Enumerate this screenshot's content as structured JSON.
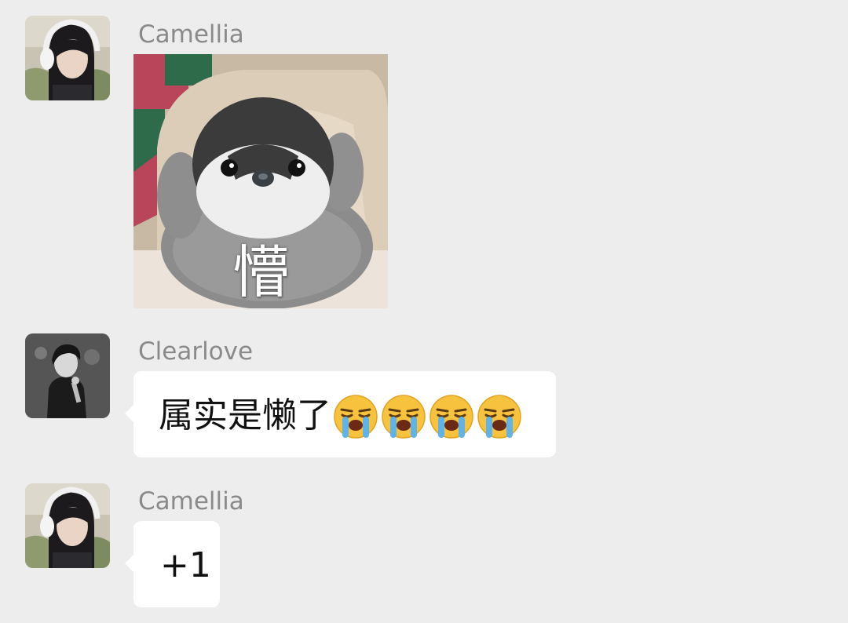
{
  "colors": {
    "background": "#ededed",
    "bubble": "#ffffff",
    "sender_name": "#8a8a8a",
    "message_text": "#111111"
  },
  "messages": [
    {
      "sender": "Camellia",
      "avatar": "avatar-girl-with-headphones",
      "type": "sticker",
      "sticker": "baby-penguin-sticker",
      "sticker_caption": "懵"
    },
    {
      "sender": "Clearlove",
      "avatar": "avatar-boy-with-microphone",
      "type": "text",
      "text": "属实是懒了",
      "emojis": [
        "loudly-crying-face",
        "loudly-crying-face",
        "loudly-crying-face",
        "loudly-crying-face"
      ]
    },
    {
      "sender": "Camellia",
      "avatar": "avatar-girl-with-headphones",
      "type": "text",
      "text": "+1"
    }
  ]
}
